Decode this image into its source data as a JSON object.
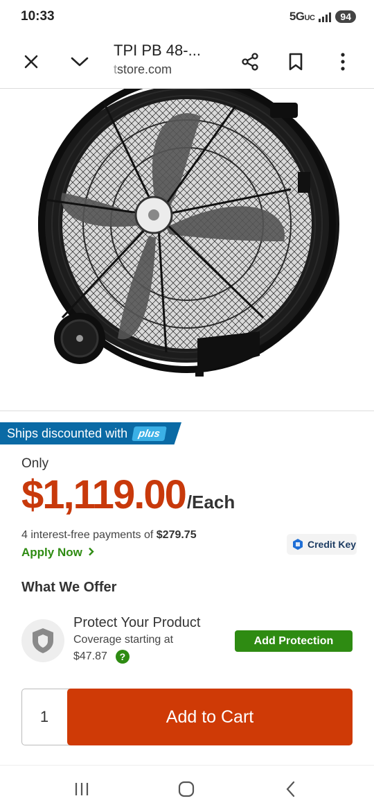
{
  "status_bar": {
    "time": "10:33",
    "network": "5G",
    "network_sub": "UC",
    "battery": "94"
  },
  "browser": {
    "title": "TPI PB 48-...",
    "url_prefix": "t",
    "url_rest": "store.com",
    "icons": [
      "close-icon",
      "chevron-down-icon",
      "share-icon",
      "bookmark-icon",
      "more-vert-icon"
    ]
  },
  "product": {
    "image_name": "black-drum-fan-with-wheel",
    "ships_text": "Ships discounted with",
    "plus_label": "plus",
    "only_label": "Only",
    "price": "$1,119.00",
    "price_unit": "/Each",
    "payments_text": "4 interest-free payments of",
    "payments_amount": "$279.75",
    "apply_now": "Apply Now",
    "credit_key": "Credit Key"
  },
  "offer": {
    "heading": "What We Offer",
    "protect_title": "Protect Your Product",
    "coverage_line1": "Coverage starting at",
    "coverage_price": "$47.87",
    "help_label": "?",
    "add_protection": "Add Protection"
  },
  "cart": {
    "quantity": "1",
    "add_to_cart": "Add to Cart"
  },
  "colors": {
    "price": "#c8390b",
    "cta": "#cf3a06",
    "green": "#2e8b12",
    "banner": "#0a6aa5",
    "plus_badge": "#3bb0e6"
  }
}
